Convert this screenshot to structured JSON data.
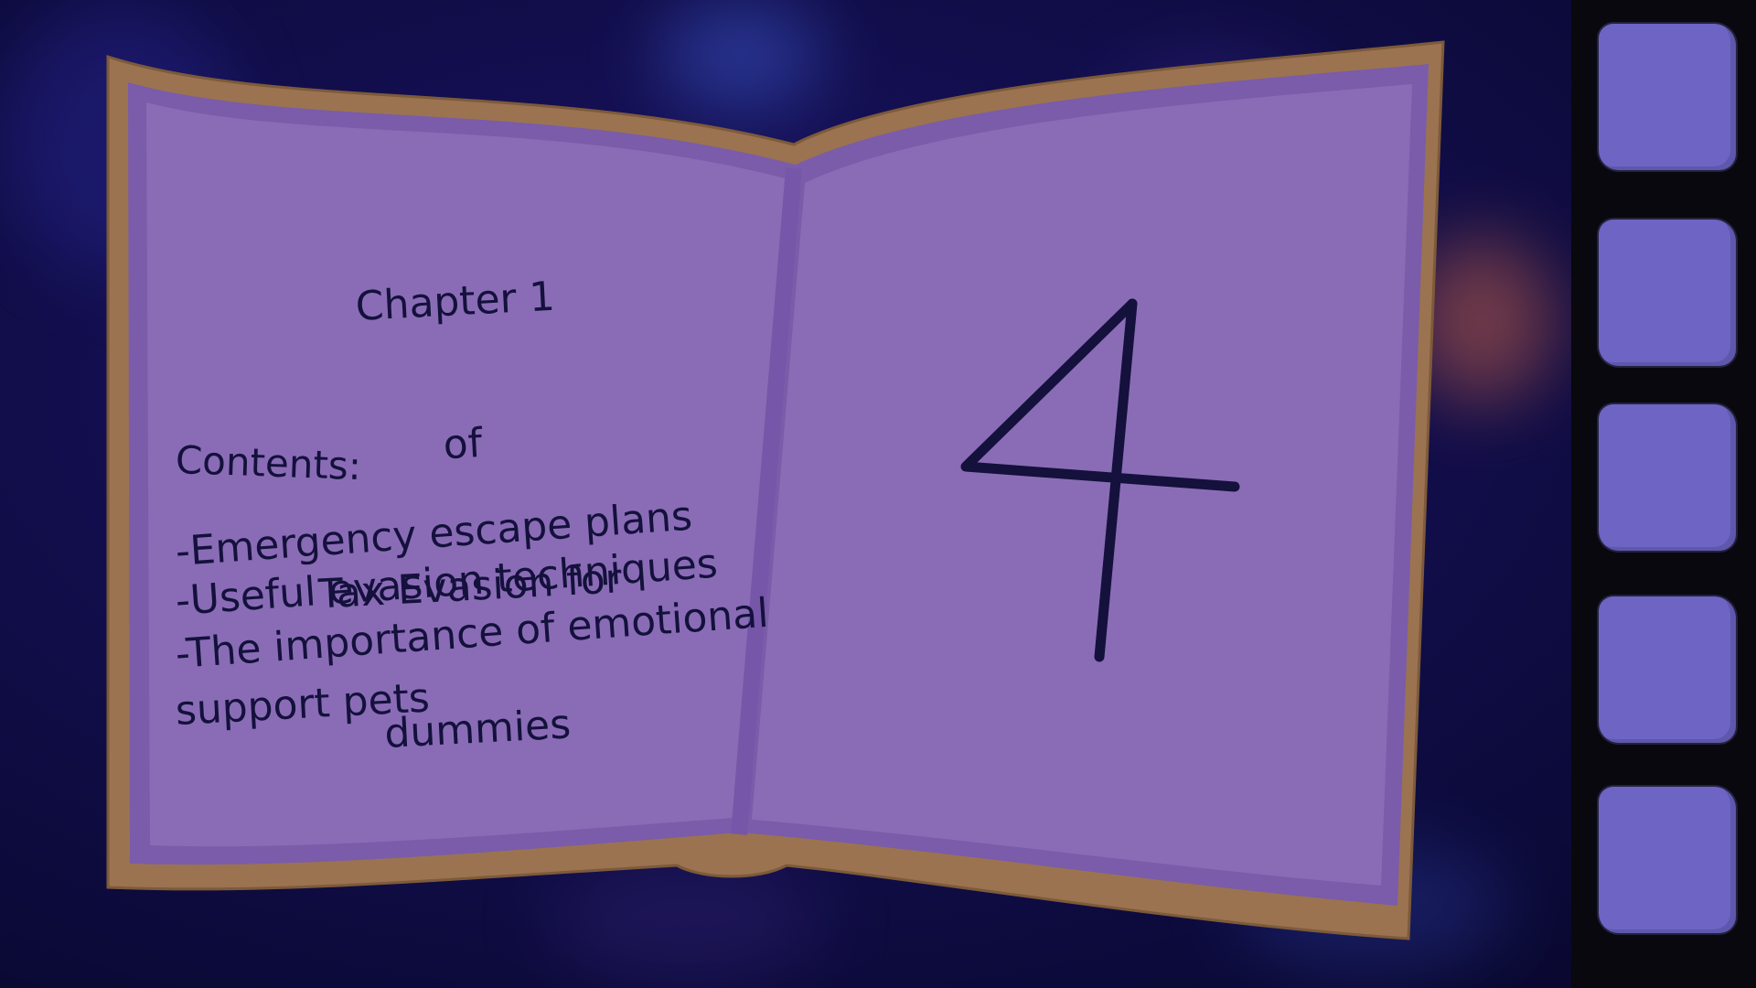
{
  "book": {
    "chapter_title_lines": [
      "Chapter 1",
      "of",
      "Tax Evasion for",
      "dummies"
    ],
    "contents_heading": "Contents:",
    "contents_items": [
      "-Emergency escape plans",
      "-Useful evasion techniques",
      "-The importance of emotional",
      "support pets"
    ],
    "page_number": "4"
  },
  "colors": {
    "page": "#8a6cb6",
    "page_edge": "#7a5caa",
    "cover": "#9b7350",
    "ink": "#14113c",
    "slot": "#6d64c4",
    "sidebar": "#08080e"
  },
  "sidebar": {
    "slot_count": 5
  }
}
